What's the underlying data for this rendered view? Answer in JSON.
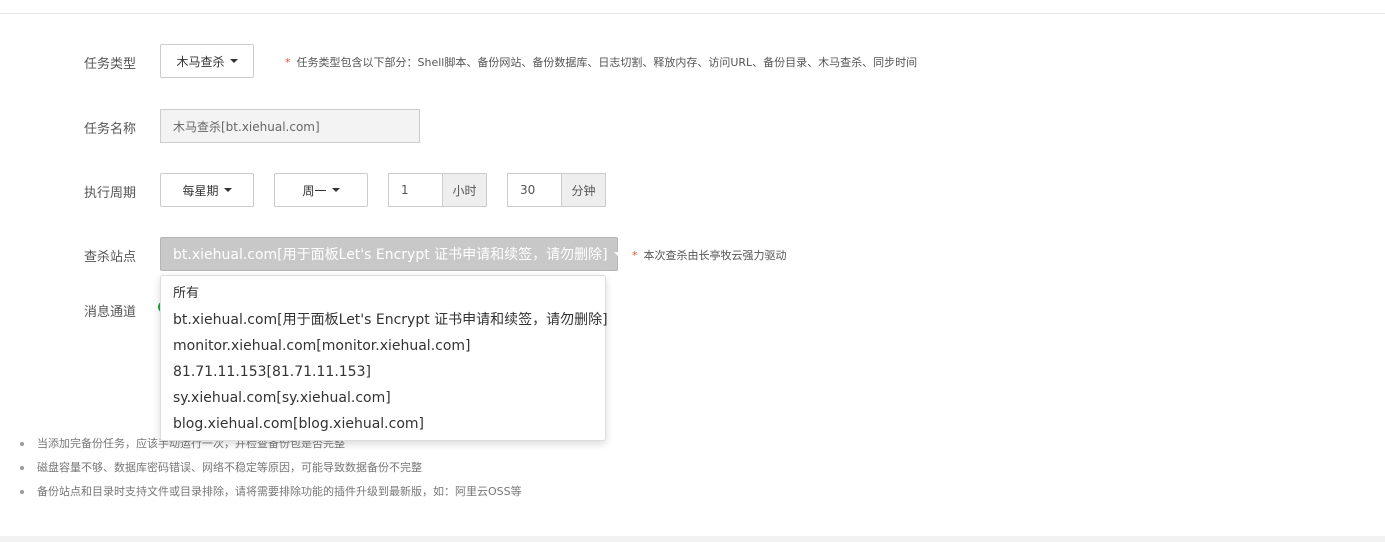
{
  "form": {
    "task_type": {
      "label": "任务类型",
      "value": "木马查杀",
      "hint_star": "*",
      "hint": "任务类型包含以下部分：Shell脚本、备份网站、备份数据库、日志切割、释放内存、访问URL、备份目录、木马查杀、同步时间"
    },
    "task_name": {
      "label": "任务名称",
      "value": "木马查杀[bt.xiehual.com]"
    },
    "period": {
      "label": "执行周期",
      "type_value": "每星期",
      "day_value": "周一",
      "hour_value": "1",
      "hour_unit": "小时",
      "minute_value": "30",
      "minute_unit": "分钟"
    },
    "site": {
      "label": "查杀站点",
      "value": "bt.xiehual.com[用于面板Let's Encrypt 证书申请和续签，请勿删除]",
      "hint_star": "*",
      "hint": "本次查杀由长亭牧云强力驱动",
      "options": [
        "所有",
        "bt.xiehual.com[用于面板Let's Encrypt 证书申请和续签，请勿删除]",
        "monitor.xiehual.com[monitor.xiehual.com]",
        "81.71.11.153[81.71.11.153]",
        "sy.xiehual.com[sy.xiehual.com]",
        "blog.xiehual.com[blog.xiehual.com]"
      ]
    },
    "message": {
      "label": "消息通道"
    }
  },
  "notes": [
    "当添加完备份任务，应该手动运行一次，并检查备份包是否完整",
    "磁盘容量不够、数据库密码错误、网络不稳定等原因，可能导致数据备份不完整",
    "备份站点和目录时支持文件或目录排除，请将需要排除功能的插件升级到最新版，如：阿里云OSS等"
  ],
  "colors": {
    "accent": "#20a53a",
    "required_star": "#e5503e"
  }
}
